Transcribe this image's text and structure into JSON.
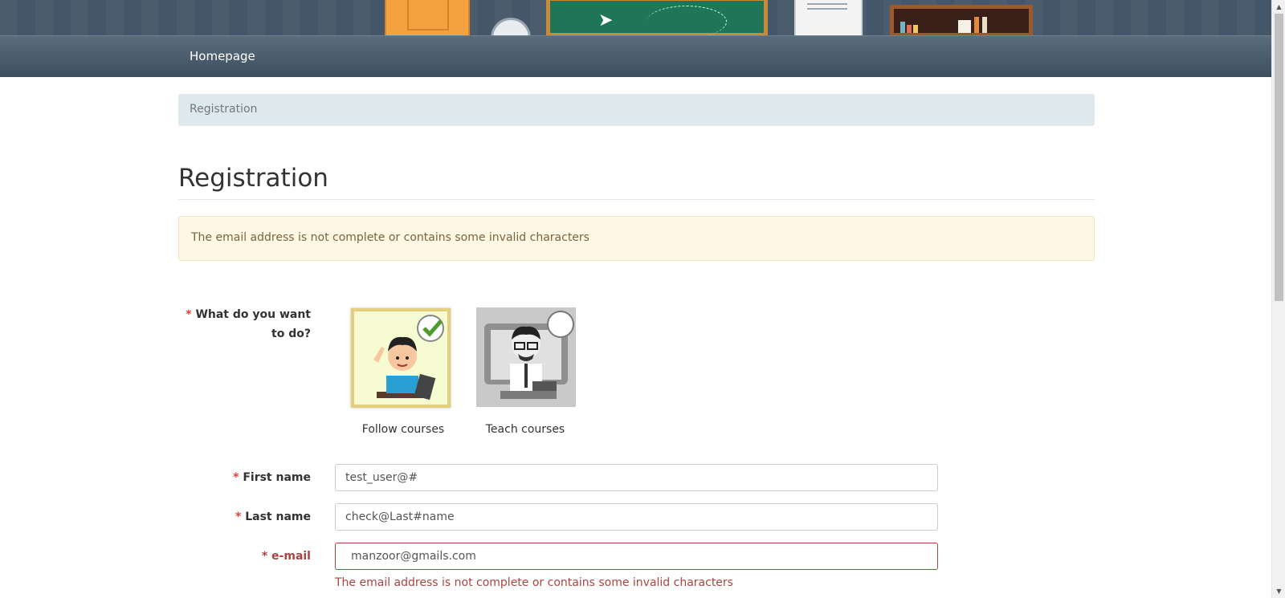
{
  "nav": {
    "homepage": "Homepage"
  },
  "breadcrumb": {
    "current": "Registration"
  },
  "page": {
    "title": "Registration"
  },
  "alert": {
    "message": "The email address is not complete or contains some invalid characters"
  },
  "form": {
    "role": {
      "label": "What do you want to do?",
      "options": [
        {
          "label": "Follow courses",
          "selected": true
        },
        {
          "label": "Teach courses",
          "selected": false
        }
      ]
    },
    "first_name": {
      "label": "First name",
      "value": "test_user@#"
    },
    "last_name": {
      "label": "Last name",
      "value": "check@Last#name"
    },
    "email": {
      "label": "e-mail",
      "value": "manzoor@gmails.com",
      "error": "The email address is not complete or contains some invalid characters"
    },
    "required_marker": "*"
  },
  "colors": {
    "error": "#a94442",
    "required": "#d9423a",
    "nav": "#3d4f5e",
    "breadcrumb_bg": "#dde9ed",
    "alert_bg": "#fdf7e3"
  }
}
